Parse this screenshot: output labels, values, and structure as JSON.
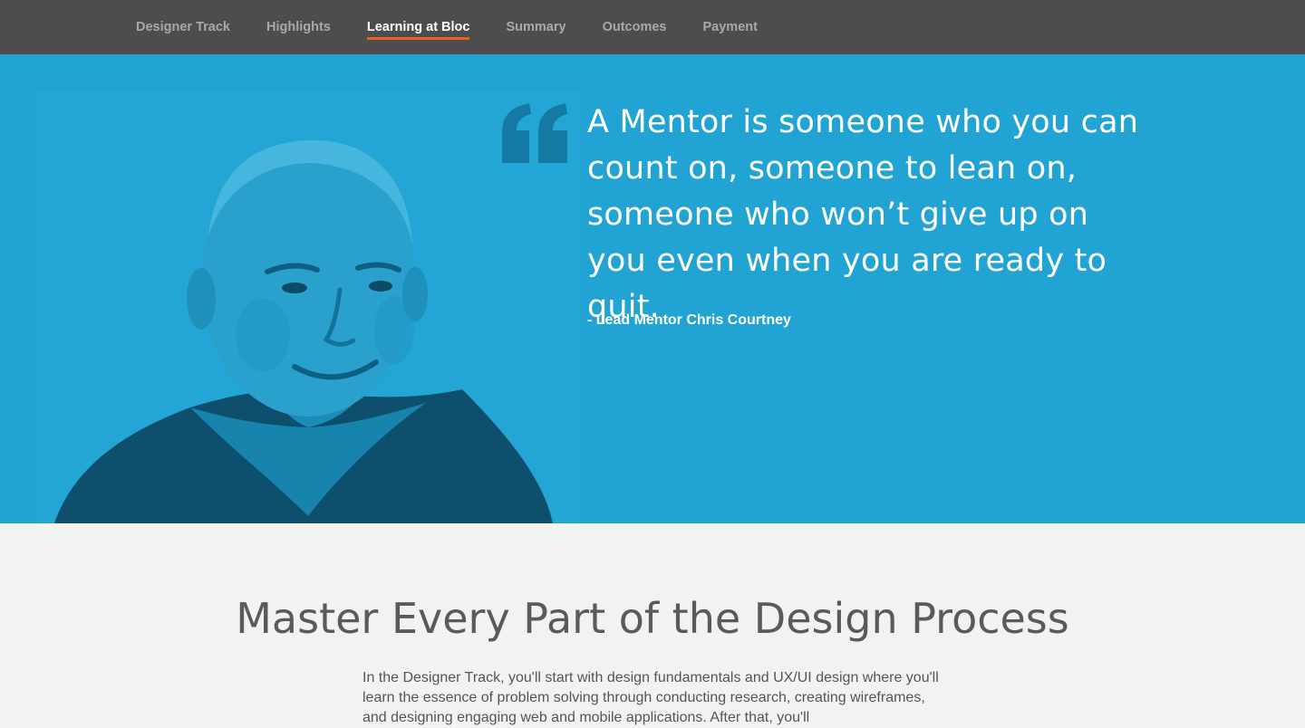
{
  "nav": {
    "items": [
      {
        "label": "Designer Track"
      },
      {
        "label": "Highlights"
      },
      {
        "label": "Learning at Bloc"
      },
      {
        "label": "Summary"
      },
      {
        "label": "Outcomes"
      },
      {
        "label": "Payment"
      }
    ],
    "active_index": 2
  },
  "hero": {
    "quote": "A Mentor is someone who you can count on, someone to lean on, someone who won’t give up on you even when you are ready to quit.",
    "author": "- Lead Mentor Chris Courtney",
    "quote_icon": "quote-mark-icon"
  },
  "section": {
    "title": "Master Every Part of the Design Process",
    "body": "In the Designer Track, you'll start with design fundamentals and UX/UI design where you'll learn the essence of problem solving through conducting research, creating wireframes, and designing engaging web and mobile applications. After that, you'll"
  },
  "colors": {
    "nav_bg": "#4d4d4d",
    "nav_active_underline": "#ee5b26",
    "hero_bg": "#21a4d4",
    "section_bg": "#f1f2f2"
  }
}
